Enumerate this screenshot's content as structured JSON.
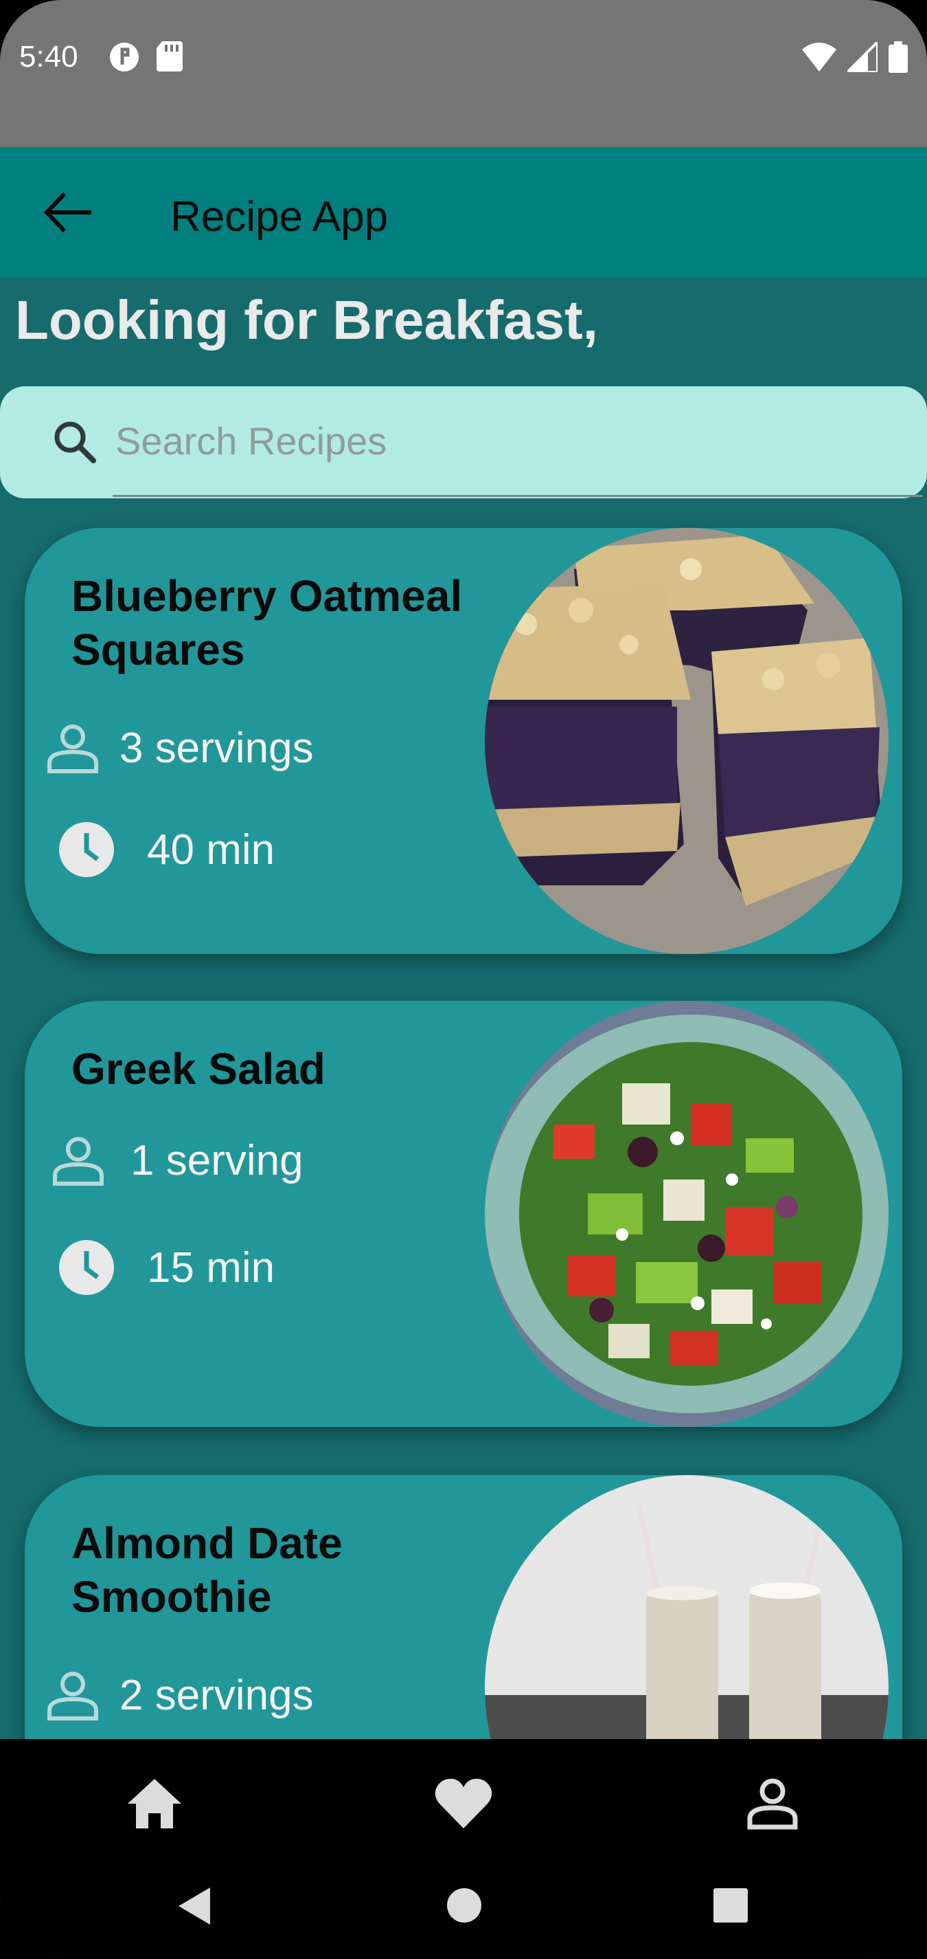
{
  "status_bar": {
    "time": "5:40"
  },
  "app_bar": {
    "title": "Recipe App"
  },
  "greeting": "Looking for Breakfast,",
  "search": {
    "placeholder": "Search Recipes"
  },
  "recipes": [
    {
      "title": "Blueberry Oatmeal Squares",
      "servings": "3 servings",
      "time": "40 min"
    },
    {
      "title": "Greek Salad",
      "servings": "1 serving",
      "time": "15 min"
    },
    {
      "title": "Almond Date Smoothie",
      "servings": "2 servings"
    }
  ],
  "icons": {
    "back": "arrow-left-icon",
    "search": "search-icon",
    "servings": "person-icon",
    "time": "clock-icon",
    "nav_home": "home-icon",
    "nav_favorites": "heart-icon",
    "nav_profile": "person-icon"
  },
  "colors": {
    "app_bar": "#007f7f",
    "background": "#166b6d",
    "card": "#21979a",
    "search_box": "#b2ebe3",
    "status_bar": "#757575"
  }
}
